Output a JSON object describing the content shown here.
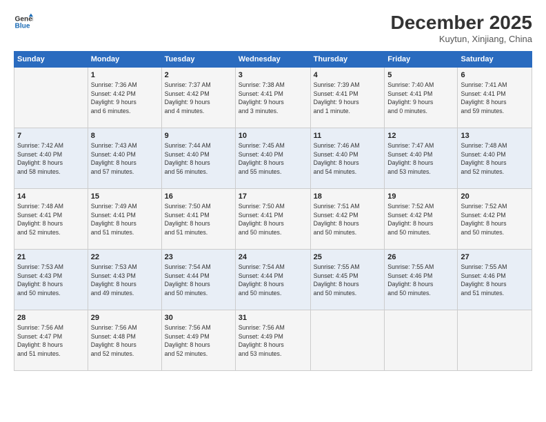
{
  "logo": {
    "line1": "General",
    "line2": "Blue"
  },
  "title": "December 2025",
  "subtitle": "Kuytun, Xinjiang, China",
  "days_header": [
    "Sunday",
    "Monday",
    "Tuesday",
    "Wednesday",
    "Thursday",
    "Friday",
    "Saturday"
  ],
  "weeks": [
    [
      {
        "num": "",
        "info": ""
      },
      {
        "num": "1",
        "info": "Sunrise: 7:36 AM\nSunset: 4:42 PM\nDaylight: 9 hours\nand 6 minutes."
      },
      {
        "num": "2",
        "info": "Sunrise: 7:37 AM\nSunset: 4:42 PM\nDaylight: 9 hours\nand 4 minutes."
      },
      {
        "num": "3",
        "info": "Sunrise: 7:38 AM\nSunset: 4:41 PM\nDaylight: 9 hours\nand 3 minutes."
      },
      {
        "num": "4",
        "info": "Sunrise: 7:39 AM\nSunset: 4:41 PM\nDaylight: 9 hours\nand 1 minute."
      },
      {
        "num": "5",
        "info": "Sunrise: 7:40 AM\nSunset: 4:41 PM\nDaylight: 9 hours\nand 0 minutes."
      },
      {
        "num": "6",
        "info": "Sunrise: 7:41 AM\nSunset: 4:41 PM\nDaylight: 8 hours\nand 59 minutes."
      }
    ],
    [
      {
        "num": "7",
        "info": "Sunrise: 7:42 AM\nSunset: 4:40 PM\nDaylight: 8 hours\nand 58 minutes."
      },
      {
        "num": "8",
        "info": "Sunrise: 7:43 AM\nSunset: 4:40 PM\nDaylight: 8 hours\nand 57 minutes."
      },
      {
        "num": "9",
        "info": "Sunrise: 7:44 AM\nSunset: 4:40 PM\nDaylight: 8 hours\nand 56 minutes."
      },
      {
        "num": "10",
        "info": "Sunrise: 7:45 AM\nSunset: 4:40 PM\nDaylight: 8 hours\nand 55 minutes."
      },
      {
        "num": "11",
        "info": "Sunrise: 7:46 AM\nSunset: 4:40 PM\nDaylight: 8 hours\nand 54 minutes."
      },
      {
        "num": "12",
        "info": "Sunrise: 7:47 AM\nSunset: 4:40 PM\nDaylight: 8 hours\nand 53 minutes."
      },
      {
        "num": "13",
        "info": "Sunrise: 7:48 AM\nSunset: 4:40 PM\nDaylight: 8 hours\nand 52 minutes."
      }
    ],
    [
      {
        "num": "14",
        "info": "Sunrise: 7:48 AM\nSunset: 4:41 PM\nDaylight: 8 hours\nand 52 minutes."
      },
      {
        "num": "15",
        "info": "Sunrise: 7:49 AM\nSunset: 4:41 PM\nDaylight: 8 hours\nand 51 minutes."
      },
      {
        "num": "16",
        "info": "Sunrise: 7:50 AM\nSunset: 4:41 PM\nDaylight: 8 hours\nand 51 minutes."
      },
      {
        "num": "17",
        "info": "Sunrise: 7:50 AM\nSunset: 4:41 PM\nDaylight: 8 hours\nand 50 minutes."
      },
      {
        "num": "18",
        "info": "Sunrise: 7:51 AM\nSunset: 4:42 PM\nDaylight: 8 hours\nand 50 minutes."
      },
      {
        "num": "19",
        "info": "Sunrise: 7:52 AM\nSunset: 4:42 PM\nDaylight: 8 hours\nand 50 minutes."
      },
      {
        "num": "20",
        "info": "Sunrise: 7:52 AM\nSunset: 4:42 PM\nDaylight: 8 hours\nand 50 minutes."
      }
    ],
    [
      {
        "num": "21",
        "info": "Sunrise: 7:53 AM\nSunset: 4:43 PM\nDaylight: 8 hours\nand 50 minutes."
      },
      {
        "num": "22",
        "info": "Sunrise: 7:53 AM\nSunset: 4:43 PM\nDaylight: 8 hours\nand 49 minutes."
      },
      {
        "num": "23",
        "info": "Sunrise: 7:54 AM\nSunset: 4:44 PM\nDaylight: 8 hours\nand 50 minutes."
      },
      {
        "num": "24",
        "info": "Sunrise: 7:54 AM\nSunset: 4:44 PM\nDaylight: 8 hours\nand 50 minutes."
      },
      {
        "num": "25",
        "info": "Sunrise: 7:55 AM\nSunset: 4:45 PM\nDaylight: 8 hours\nand 50 minutes."
      },
      {
        "num": "26",
        "info": "Sunrise: 7:55 AM\nSunset: 4:46 PM\nDaylight: 8 hours\nand 50 minutes."
      },
      {
        "num": "27",
        "info": "Sunrise: 7:55 AM\nSunset: 4:46 PM\nDaylight: 8 hours\nand 51 minutes."
      }
    ],
    [
      {
        "num": "28",
        "info": "Sunrise: 7:56 AM\nSunset: 4:47 PM\nDaylight: 8 hours\nand 51 minutes."
      },
      {
        "num": "29",
        "info": "Sunrise: 7:56 AM\nSunset: 4:48 PM\nDaylight: 8 hours\nand 52 minutes."
      },
      {
        "num": "30",
        "info": "Sunrise: 7:56 AM\nSunset: 4:49 PM\nDaylight: 8 hours\nand 52 minutes."
      },
      {
        "num": "31",
        "info": "Sunrise: 7:56 AM\nSunset: 4:49 PM\nDaylight: 8 hours\nand 53 minutes."
      },
      {
        "num": "",
        "info": ""
      },
      {
        "num": "",
        "info": ""
      },
      {
        "num": "",
        "info": ""
      }
    ]
  ]
}
